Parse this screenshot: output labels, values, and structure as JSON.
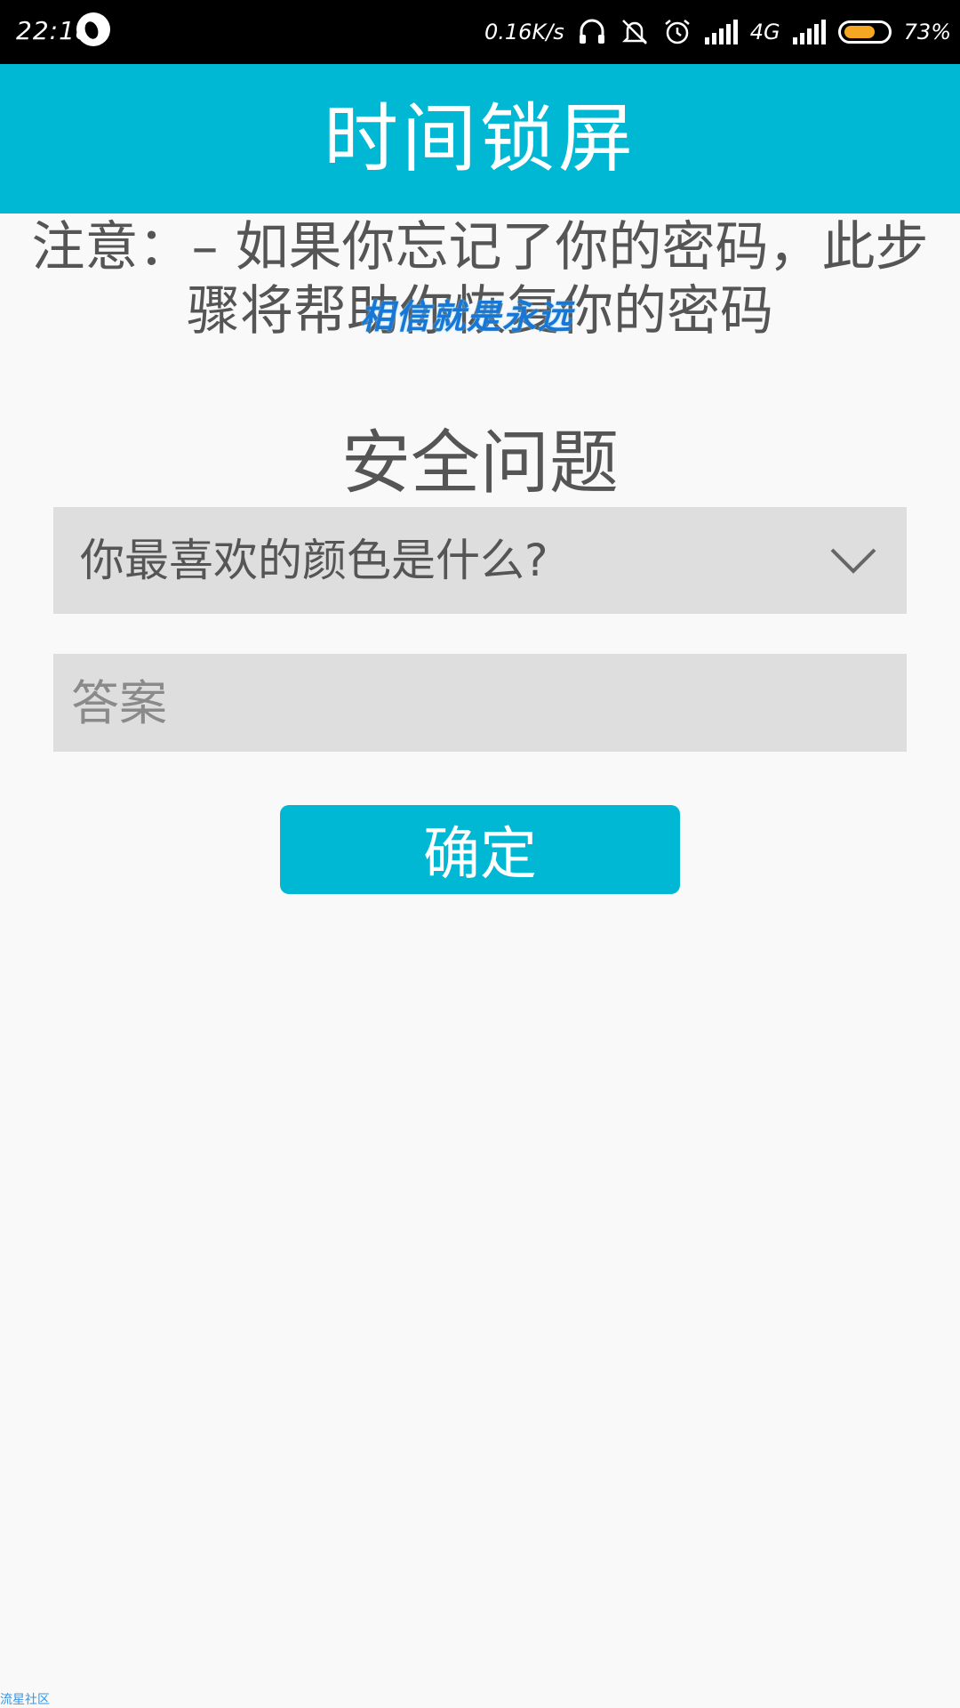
{
  "status_bar": {
    "time": "22:18",
    "net_speed": "0.16K/s",
    "network_type": "4G",
    "battery": "73%",
    "battery_level": 0.73,
    "icons": [
      "app-notification-icon",
      "headset-icon",
      "bell-muted-icon",
      "alarm-icon",
      "signal-icon",
      "signal-icon",
      "battery-icon"
    ]
  },
  "app_bar": {
    "title": "时间锁屏"
  },
  "notice": {
    "text": "注意：– 如果你忘记了你的密码，此步骤将帮助你恢复你的密码"
  },
  "overlay": {
    "text": "相信就是永远"
  },
  "security": {
    "title": "安全问题",
    "question_selected": "你最喜欢的颜色是什么?",
    "answer_placeholder": "答案",
    "answer_value": "",
    "confirm_label": "确定"
  },
  "watermark": {
    "text": "流星社区"
  },
  "colors": {
    "accent": "#00b8d4",
    "field_bg": "#dedede",
    "page_bg": "#f9f9f9",
    "text": "#555555",
    "battery": "#f5a623"
  }
}
